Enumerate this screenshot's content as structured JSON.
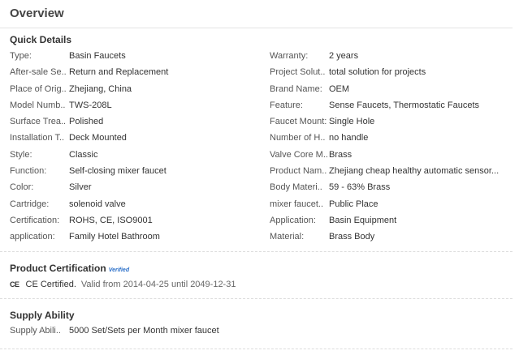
{
  "overview_title": "Overview",
  "quick_details": {
    "title": "Quick Details",
    "rows": [
      [
        {
          "label": "Type:",
          "value": "Basin Faucets"
        },
        {
          "label": "Warranty:",
          "value": "2 years"
        }
      ],
      [
        {
          "label": "After-sale Se..",
          "value": "Return and Replacement"
        },
        {
          "label": "Project Solut..",
          "value": "total solution for projects"
        }
      ],
      [
        {
          "label": "Place of Orig..",
          "value": "Zhejiang, China"
        },
        {
          "label": "Brand Name:",
          "value": "OEM"
        }
      ],
      [
        {
          "label": "Model Numb..",
          "value": "TWS-208L"
        },
        {
          "label": "Feature:",
          "value": "Sense Faucets, Thermostatic Faucets"
        }
      ],
      [
        {
          "label": "Surface Trea..",
          "value": "Polished"
        },
        {
          "label": "Faucet Mount:",
          "value": "Single Hole"
        }
      ],
      [
        {
          "label": "Installation T..",
          "value": "Deck Mounted"
        },
        {
          "label": "Number of H..",
          "value": "no handle"
        }
      ],
      [
        {
          "label": "Style:",
          "value": "Classic"
        },
        {
          "label": "Valve Core M..",
          "value": "Brass"
        }
      ],
      [
        {
          "label": "Function:",
          "value": "Self-closing mixer faucet"
        },
        {
          "label": "Product Nam..",
          "value": "Zhejiang cheap healthy automatic sensor..."
        }
      ],
      [
        {
          "label": "Color:",
          "value": "Silver"
        },
        {
          "label": "Body Materi..",
          "value": "59 - 63% Brass"
        }
      ],
      [
        {
          "label": "Cartridge:",
          "value": "solenoid valve"
        },
        {
          "label": "mixer faucet..",
          "value": "Public Place"
        }
      ],
      [
        {
          "label": "Certification:",
          "value": "ROHS, CE, ISO9001"
        },
        {
          "label": "Application:",
          "value": "Basin Equipment"
        }
      ],
      [
        {
          "label": "application:",
          "value": "Family Hotel Bathroom"
        },
        {
          "label": "Material:",
          "value": "Brass Body"
        }
      ]
    ]
  },
  "product_certification": {
    "title": "Product Certification",
    "verified_badge": "Verified",
    "ce_icon_text": "CE",
    "cert_name": "CE Certified.",
    "validity": "Valid from 2014-04-25 until 2049-12-31"
  },
  "supply_ability": {
    "title": "Supply Ability",
    "label": "Supply Abili..",
    "value": "5000 Set/Sets per Month mixer faucet"
  }
}
